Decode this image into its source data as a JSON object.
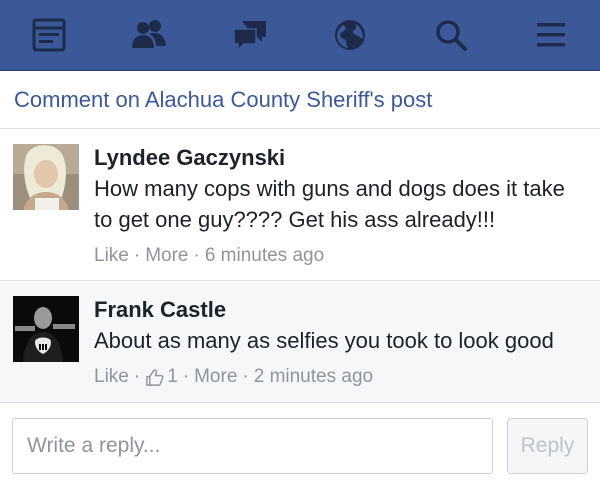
{
  "navbar": {
    "background": "#3b5998",
    "icons": [
      "feed-icon",
      "friends-icon",
      "messages-icon",
      "notifications-globe-icon",
      "search-icon",
      "menu-icon"
    ]
  },
  "header": {
    "title": "Comment on Alachua County Sheriff's post"
  },
  "comments": [
    {
      "author": "Lyndee Gaczynski",
      "text": "How many cops with guns and dogs does it take to get one guy???? Get his ass already!!!",
      "like_label": "Like",
      "more_label": "More",
      "time": "6 minutes ago"
    },
    {
      "author": "Frank Castle",
      "text": "About as many as selfies you took to look good",
      "like_label": "Like",
      "like_count": "1",
      "more_label": "More",
      "time": "2 minutes ago"
    }
  ],
  "reply": {
    "placeholder": "Write a reply...",
    "button_label": "Reply"
  },
  "colors": {
    "link": "#3b5998",
    "meta": "#90949c",
    "text": "#1d2129"
  }
}
